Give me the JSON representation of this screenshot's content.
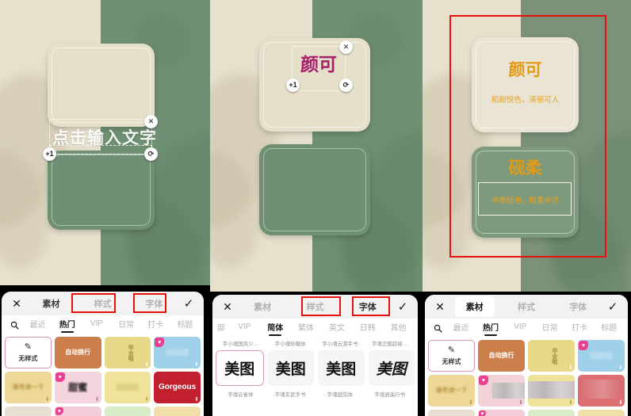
{
  "app": {
    "canvas_hint_text": "点击输入文字",
    "colors": {
      "cream_bg": "#e7e0cc",
      "green_bg": "#6f9072",
      "gold_text": "#e39b15",
      "magenta_text": "#a8206b",
      "annotation_red": "#e8100f",
      "selected_pink": "#d98fae"
    }
  },
  "panel1": {
    "canvas": {
      "hint_text": "点击输入文字",
      "handles": {
        "delete": "✕",
        "add": "+1",
        "rotate": "⟳"
      }
    },
    "toolbar": {
      "close_label": "✕",
      "confirm_label": "✓",
      "tabs": [
        {
          "label": "素材",
          "active": false
        },
        {
          "label": "样式",
          "active": false,
          "highlighted": true
        },
        {
          "label": "字体",
          "active": false,
          "highlighted": true
        }
      ]
    },
    "categories": [
      {
        "label": "最近",
        "active": false
      },
      {
        "label": "热门",
        "active": true
      },
      {
        "label": "VIP",
        "active": false
      },
      {
        "label": "日常",
        "active": false
      },
      {
        "label": "打卡",
        "active": false
      },
      {
        "label": "标题",
        "active": false
      }
    ],
    "search_icon": "search-icon",
    "styles": [
      {
        "label": "无样式",
        "selected": true,
        "bg": "#ffffff",
        "color": "#333333",
        "icon": "pencil-icon"
      },
      {
        "label": "自动换行",
        "selected": false,
        "bg": "#cc7f4a",
        "color": "#ffffff"
      },
      {
        "label": "毕业啦",
        "selected": false,
        "bg": "#e8d98a",
        "color": "#a08a3c"
      },
      {
        "label": "",
        "selected": false,
        "bg": "#9fd0ea",
        "color": "#ffffff",
        "vip": true
      },
      {
        "label": "请考虑一下",
        "selected": false,
        "bg": "#edd897",
        "color": "#b99648"
      },
      {
        "label": "甜蜜",
        "selected": false,
        "bg": "#f4d4dd",
        "color": "#222222",
        "vip": true
      },
      {
        "label": "",
        "selected": false,
        "bg": "#efe39a",
        "color": "#b8a14e"
      },
      {
        "label": "Gorgeous",
        "selected": false,
        "bg": "#c3202f",
        "color": "#ffffff"
      },
      {
        "label": "",
        "selected": false,
        "bg": "#e7e0d2",
        "color": "#888888"
      },
      {
        "label": "",
        "selected": false,
        "bg": "#f3cdd8",
        "color": "#888888",
        "vip": true
      },
      {
        "label": "",
        "selected": false,
        "bg": "#d8ecc8",
        "color": "#888888"
      },
      {
        "label": "",
        "selected": false,
        "bg": "#f0dfa8",
        "color": "#888888"
      }
    ]
  },
  "panel2": {
    "canvas": {
      "card_text": "颜可",
      "handles": {
        "delete": "✕",
        "add": "+1",
        "rotate": "⟳"
      }
    },
    "toolbar": {
      "close_label": "✕",
      "confirm_label": "✓",
      "tabs": [
        {
          "label": "素材",
          "active": false
        },
        {
          "label": "样式",
          "active": false,
          "highlighted": true
        },
        {
          "label": "字体",
          "active": false,
          "highlighted": true
        }
      ]
    },
    "categories": [
      {
        "label": "部",
        "active": false,
        "cut": true
      },
      {
        "label": "VIP",
        "active": false
      },
      {
        "label": "简体",
        "active": true
      },
      {
        "label": "繁体",
        "active": false
      },
      {
        "label": "英文",
        "active": false
      },
      {
        "label": "日韩",
        "active": false
      },
      {
        "label": "其他",
        "active": false
      }
    ],
    "font_names_top": [
      "字小魂国风少…",
      "字小魂砂糖体",
      "字小魂云游手书",
      "字魂正酷超级…"
    ],
    "font_samples": [
      {
        "glyph": "美图",
        "selected": true,
        "name": "字魂云雀体"
      },
      {
        "glyph": "美图",
        "selected": false,
        "name": "字魂玄武手书"
      },
      {
        "glyph": "美图",
        "selected": false,
        "name": "字魂庭院体"
      },
      {
        "glyph": "美图",
        "selected": false,
        "name": "字魂逍遥行书"
      }
    ]
  },
  "panel3": {
    "canvas": {
      "annotation": "red-rectangle-highlight",
      "cards": [
        {
          "title": "颜可",
          "subtitle": "和颜悦色，清丽可人",
          "style": "cream"
        },
        {
          "title": "砚柔",
          "subtitle": "书香砚池，刚柔并济",
          "style": "green"
        }
      ]
    },
    "toolbar": {
      "close_label": "✕",
      "confirm_label": "✓",
      "tabs": [
        {
          "label": "素材",
          "active": true
        },
        {
          "label": "样式",
          "active": false
        },
        {
          "label": "字体",
          "active": false
        }
      ]
    },
    "categories": [
      {
        "label": "最近",
        "active": false
      },
      {
        "label": "热门",
        "active": true
      },
      {
        "label": "VIP",
        "active": false
      },
      {
        "label": "日常",
        "active": false
      },
      {
        "label": "打卡",
        "active": false
      },
      {
        "label": "标题",
        "active": false
      }
    ],
    "search_icon": "search-icon",
    "styles": [
      {
        "label": "无样式",
        "selected": true,
        "bg": "#ffffff",
        "color": "#333333",
        "icon": "pencil-icon"
      },
      {
        "label": "自动换行",
        "selected": false,
        "bg": "#cc7f4a",
        "color": "#ffffff"
      },
      {
        "label": "毕业啦",
        "selected": false,
        "bg": "#e8d98a",
        "color": "#a08a3c"
      },
      {
        "label": "",
        "selected": false,
        "bg": "#9fd0ea",
        "color": "#ffffff",
        "vip": true
      },
      {
        "label": "请考虑一下",
        "selected": false,
        "bg": "#edd897",
        "color": "#b99648"
      },
      {
        "label": "甜蜜",
        "selected": false,
        "bg": "#f4d4dd",
        "color": "#222222",
        "vip": true
      },
      {
        "label": "",
        "selected": false,
        "bg": "#efe39a",
        "color": "#b8a14e"
      },
      {
        "label": "",
        "selected": false,
        "bg": "#dd6e72",
        "color": "#ffffff"
      },
      {
        "label": "",
        "selected": false,
        "bg": "#e7e0d2",
        "color": "#888888"
      },
      {
        "label": "",
        "selected": false,
        "bg": "#f3cdd8",
        "color": "#888888",
        "vip": true
      },
      {
        "label": "",
        "selected": false,
        "bg": "#d8ecc8",
        "color": "#888888"
      },
      {
        "label": "",
        "selected": false,
        "bg": "#f0dfa8",
        "color": "#888888"
      }
    ]
  }
}
